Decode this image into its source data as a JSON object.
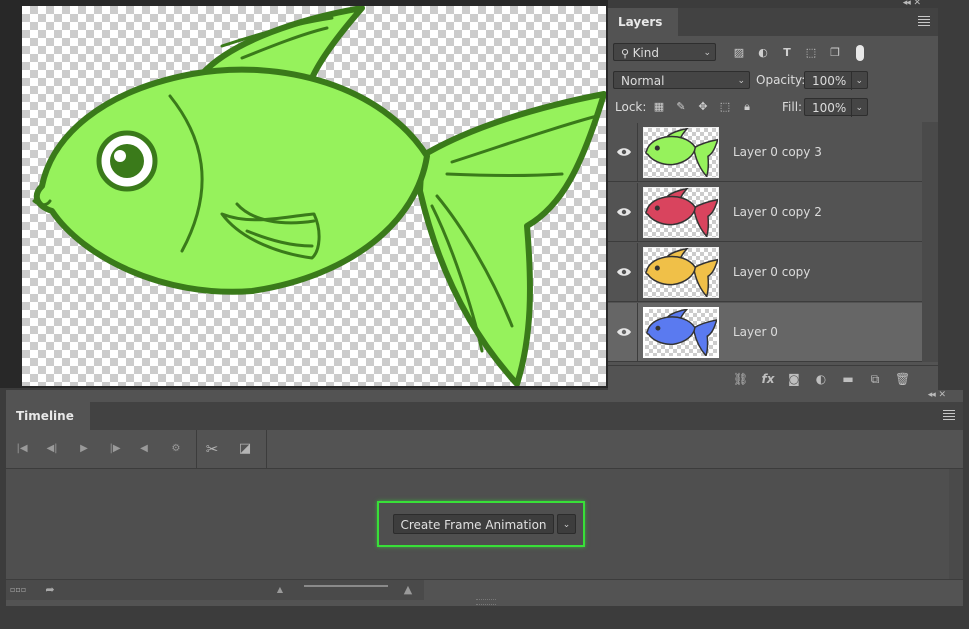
{
  "colors": {
    "fish_green": "#96f25c",
    "fish_red": "#d9445e",
    "fish_yellow": "#f0c048",
    "fish_blue": "#5a7af0",
    "outline": "#3a7a1a",
    "highlight": "#38e038"
  },
  "layers_panel": {
    "title": "Layers",
    "filter_kind": "Kind",
    "blend_mode": "Normal",
    "opacity_label": "Opacity:",
    "opacity_value": "100%",
    "lock_label": "Lock:",
    "fill_label": "Fill:",
    "fill_value": "100%",
    "layers": [
      {
        "name": "Layer 0 copy 3",
        "color": "#96f25c",
        "selected": false
      },
      {
        "name": "Layer 0 copy 2",
        "color": "#d9445e",
        "selected": false
      },
      {
        "name": "Layer 0 copy",
        "color": "#f0c048",
        "selected": false
      },
      {
        "name": "Layer 0",
        "color": "#5a7af0",
        "selected": true
      }
    ]
  },
  "timeline_panel": {
    "title": "Timeline",
    "create_button": "Create Frame Animation"
  }
}
